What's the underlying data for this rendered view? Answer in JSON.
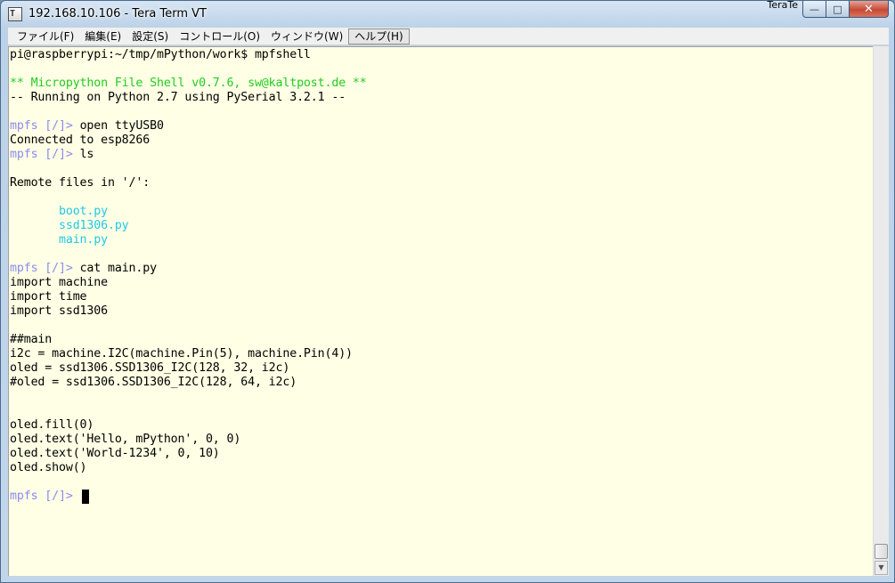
{
  "window": {
    "title": "192.168.10.106 - Tera Term VT",
    "app_icon_label": "T",
    "caption_tab": "TeraTe",
    "buttons": {
      "minimize": "—",
      "maximize": "□",
      "close": "✕"
    }
  },
  "menu": {
    "items": [
      {
        "label": "ファイル(F)"
      },
      {
        "label": "編集(E)"
      },
      {
        "label": "設定(S)"
      },
      {
        "label": "コントロール(O)"
      },
      {
        "label": "ウィンドウ(W)"
      },
      {
        "label": "ヘルプ(H)"
      }
    ]
  },
  "terminal": {
    "colors": {
      "background": "#ffffe5",
      "prompt": "#8a8af0",
      "green": "#22cc22",
      "cyan": "#20c8e6",
      "text": "#000000"
    },
    "lines": [
      {
        "segments": [
          {
            "text": "pi@raspberrypi:~/tmp/mPython/work$ mpfshell",
            "color": "text"
          }
        ]
      },
      {
        "segments": []
      },
      {
        "segments": [
          {
            "text": "** Micropython File Shell v0.7.6, sw@kaltpost.de **",
            "color": "green"
          }
        ]
      },
      {
        "segments": [
          {
            "text": "-- Running on Python 2.7 using PySerial 3.2.1 --",
            "color": "text"
          }
        ]
      },
      {
        "segments": []
      },
      {
        "segments": [
          {
            "text": "mpfs [/]> ",
            "color": "prompt"
          },
          {
            "text": "open ttyUSB0",
            "color": "text"
          }
        ]
      },
      {
        "segments": [
          {
            "text": "Connected to esp8266",
            "color": "text"
          }
        ]
      },
      {
        "segments": [
          {
            "text": "mpfs [/]> ",
            "color": "prompt"
          },
          {
            "text": "ls",
            "color": "text"
          }
        ]
      },
      {
        "segments": []
      },
      {
        "segments": [
          {
            "text": "Remote files in '/':",
            "color": "text"
          }
        ]
      },
      {
        "segments": []
      },
      {
        "segments": [
          {
            "text": "       boot.py",
            "color": "cyan"
          }
        ]
      },
      {
        "segments": [
          {
            "text": "       ssd1306.py",
            "color": "cyan"
          }
        ]
      },
      {
        "segments": [
          {
            "text": "       main.py",
            "color": "cyan"
          }
        ]
      },
      {
        "segments": []
      },
      {
        "segments": [
          {
            "text": "mpfs [/]> ",
            "color": "prompt"
          },
          {
            "text": "cat main.py",
            "color": "text"
          }
        ]
      },
      {
        "segments": [
          {
            "text": "import machine",
            "color": "text"
          }
        ]
      },
      {
        "segments": [
          {
            "text": "import time",
            "color": "text"
          }
        ]
      },
      {
        "segments": [
          {
            "text": "import ssd1306",
            "color": "text"
          }
        ]
      },
      {
        "segments": []
      },
      {
        "segments": [
          {
            "text": "##main",
            "color": "text"
          }
        ]
      },
      {
        "segments": [
          {
            "text": "i2c = machine.I2C(machine.Pin(5), machine.Pin(4))",
            "color": "text"
          }
        ]
      },
      {
        "segments": [
          {
            "text": "oled = ssd1306.SSD1306_I2C(128, 32, i2c)",
            "color": "text"
          }
        ]
      },
      {
        "segments": [
          {
            "text": "#oled = ssd1306.SSD1306_I2C(128, 64, i2c)",
            "color": "text"
          }
        ]
      },
      {
        "segments": []
      },
      {
        "segments": []
      },
      {
        "segments": [
          {
            "text": "oled.fill(0)",
            "color": "text"
          }
        ]
      },
      {
        "segments": [
          {
            "text": "oled.text('Hello, mPython', 0, 0)",
            "color": "text"
          }
        ]
      },
      {
        "segments": [
          {
            "text": "oled.text('World-1234', 0, 10)",
            "color": "text"
          }
        ]
      },
      {
        "segments": [
          {
            "text": "oled.show()",
            "color": "text"
          }
        ]
      },
      {
        "segments": []
      },
      {
        "segments": [
          {
            "text": "mpfs [/]> ",
            "color": "prompt"
          }
        ]
      }
    ]
  },
  "scrollbar": {
    "down_arrow": "▼"
  }
}
